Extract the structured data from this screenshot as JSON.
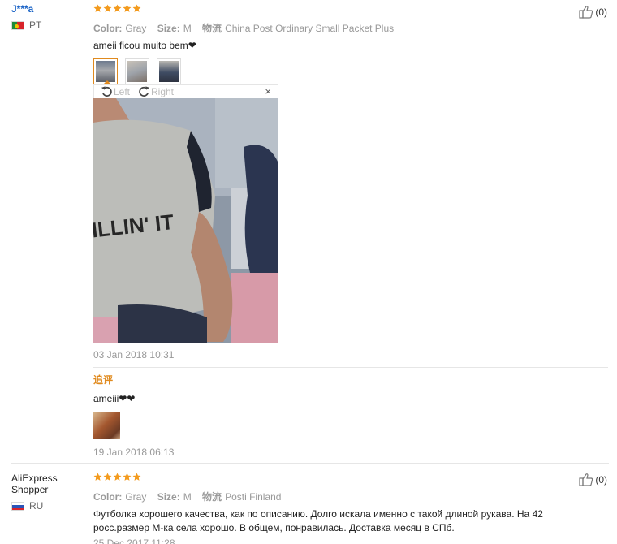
{
  "reviews": [
    {
      "user": {
        "name": "J***a",
        "country": "PT"
      },
      "rating": 5,
      "attributes": [
        {
          "key": "Color:",
          "value": "Gray"
        },
        {
          "key": "Size:",
          "value": "M"
        },
        {
          "key": "物流",
          "value": "China Post Ordinary Small Packet Plus"
        }
      ],
      "text": "ameii ficou muito bem❤",
      "images_count": 3,
      "viewer": {
        "left_label": "Left",
        "right_label": "Right",
        "close_label": "×"
      },
      "date": "03 Jan 2018 10:31",
      "helpful": "(0)",
      "followup": {
        "label": "追评",
        "text": "ameiii❤❤",
        "date": "19 Jan 2018 06:13"
      }
    },
    {
      "user": {
        "name": "AliExpress Shopper",
        "country": "RU"
      },
      "rating": 5,
      "attributes": [
        {
          "key": "Color:",
          "value": "Gray"
        },
        {
          "key": "Size:",
          "value": "M"
        },
        {
          "key": "物流",
          "value": "Posti Finland"
        }
      ],
      "text": "Футболка хорошего качества, как по описанию. Долго искала именно с такой длиной рукава. На 42 росс.размер М-ка села хорошо. В общем, понравилась. Доставка месяц в СПб.",
      "date": "25 Dec 2017 11:28",
      "helpful": "(0)"
    }
  ],
  "colors": {
    "star": "#f39a1d",
    "link": "#1a63c6",
    "accent": "#e08a1e"
  }
}
